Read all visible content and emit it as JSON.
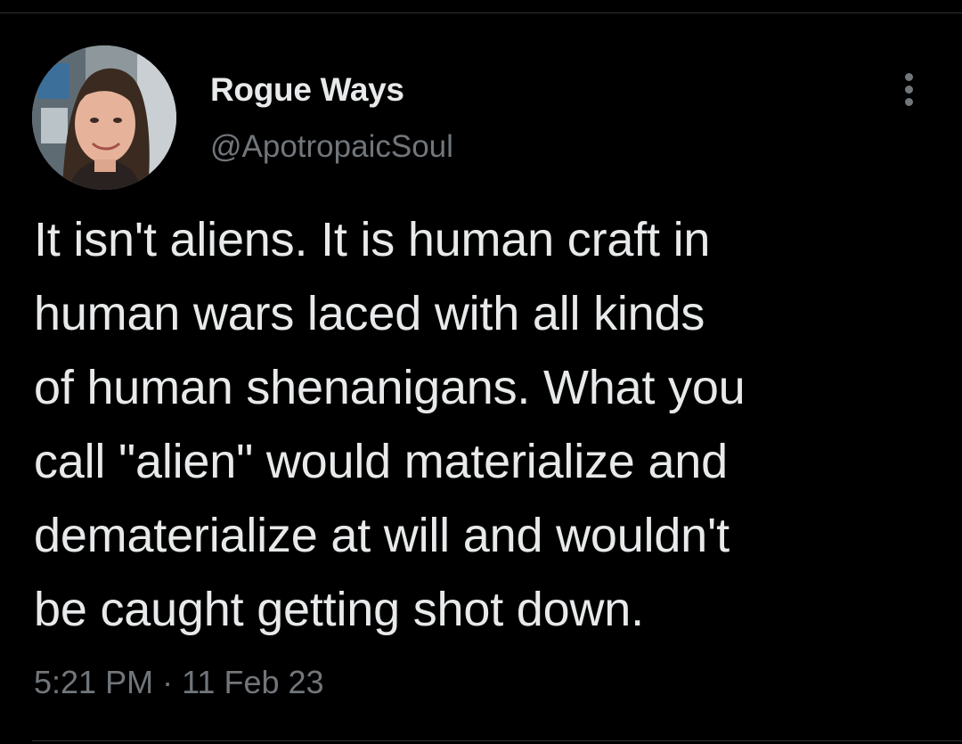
{
  "theme": {
    "background": "#000000",
    "text_primary": "#e7e9ea",
    "text_secondary": "#71767b",
    "divider": "#2f3336"
  },
  "author": {
    "display_name": "Rogue Ways",
    "handle": "@ApotropaicSoul",
    "avatar_icon": "profile-photo"
  },
  "menu": {
    "icon": "more-vertical-icon"
  },
  "tweet": {
    "lines": [
      "It isn't aliens. It is human craft in",
      "human wars laced with all kinds",
      "of human shenanigans. What you",
      "call \"alien\" would materialize and",
      "dematerialize at will and wouldn't",
      "be caught getting shot down."
    ],
    "time": "5:21 PM",
    "separator": "·",
    "date": "11 Feb 23"
  }
}
